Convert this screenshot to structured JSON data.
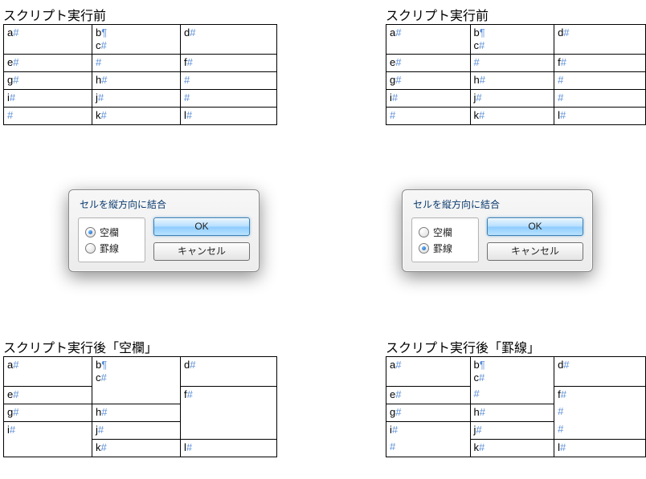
{
  "headings": {
    "left_before": "スクリプト実行前",
    "right_before": "スクリプト実行前",
    "left_after": "スクリプト実行後「空欄」",
    "right_after": "スクリプト実行後「罫線」"
  },
  "marks": {
    "hash": "#",
    "pilcrow": "¶"
  },
  "dialog": {
    "title": "セルを縦方向に結合",
    "option_blank": "空欄",
    "option_rule": "罫線",
    "ok": "OK",
    "cancel": "キャンセル"
  },
  "before": {
    "rows": [
      [
        {
          "t": "a",
          "m": "#"
        },
        {
          "lines": [
            {
              "t": "b",
              "m": "¶"
            },
            {
              "t": "c",
              "m": "#"
            }
          ]
        },
        {
          "t": "d",
          "m": "#"
        }
      ],
      [
        {
          "t": "e",
          "m": "#"
        },
        {
          "t": "",
          "m": "#"
        },
        {
          "t": "f",
          "m": "#"
        }
      ],
      [
        {
          "t": "g",
          "m": "#"
        },
        {
          "t": "h",
          "m": "#"
        },
        {
          "t": "",
          "m": "#"
        }
      ],
      [
        {
          "t": "i",
          "m": "#"
        },
        {
          "t": "j",
          "m": "#"
        },
        {
          "t": "",
          "m": "#"
        }
      ],
      [
        {
          "t": "",
          "m": "#"
        },
        {
          "t": "k",
          "m": "#"
        },
        {
          "t": "l",
          "m": "#"
        }
      ]
    ]
  },
  "after_blank": {
    "rows": [
      [
        {
          "t": "a",
          "m": "#"
        },
        {
          "lines": [
            {
              "t": "b",
              "m": "¶"
            },
            {
              "t": "c",
              "m": "#"
            }
          ],
          "nb": true
        },
        {
          "t": "d",
          "m": "#"
        }
      ],
      [
        {
          "t": "e",
          "m": "#"
        },
        {
          "empty": true,
          "nt": true
        },
        {
          "t": "f",
          "m": "#",
          "nb": true
        }
      ],
      [
        {
          "t": "g",
          "m": "#"
        },
        {
          "t": "h",
          "m": "#"
        },
        {
          "empty": true,
          "nt": true,
          "nb": true
        }
      ],
      [
        {
          "t": "i",
          "m": "#",
          "nb": true
        },
        {
          "t": "j",
          "m": "#"
        },
        {
          "empty": true,
          "nt": true
        }
      ],
      [
        {
          "empty": true,
          "nt": true
        },
        {
          "t": "k",
          "m": "#"
        },
        {
          "t": "l",
          "m": "#"
        }
      ]
    ]
  },
  "after_rule": {
    "rows": [
      [
        {
          "t": "a",
          "m": "#"
        },
        {
          "lines": [
            {
              "t": "b",
              "m": "¶"
            },
            {
              "t": "c",
              "m": "#"
            }
          ],
          "nb": true
        },
        {
          "t": "d",
          "m": "#"
        }
      ],
      [
        {
          "t": "e",
          "m": "#"
        },
        {
          "t": "",
          "m": "#",
          "nt": true
        },
        {
          "t": "f",
          "m": "#",
          "nb": true
        }
      ],
      [
        {
          "t": "g",
          "m": "#"
        },
        {
          "t": "h",
          "m": "#"
        },
        {
          "t": "",
          "m": "#",
          "nt": true,
          "nb": true
        }
      ],
      [
        {
          "t": "i",
          "m": "#",
          "nb": true
        },
        {
          "t": "j",
          "m": "#"
        },
        {
          "t": "",
          "m": "#",
          "nt": true
        }
      ],
      [
        {
          "t": "",
          "m": "#",
          "nt": true
        },
        {
          "t": "k",
          "m": "#"
        },
        {
          "t": "l",
          "m": "#"
        }
      ]
    ]
  }
}
